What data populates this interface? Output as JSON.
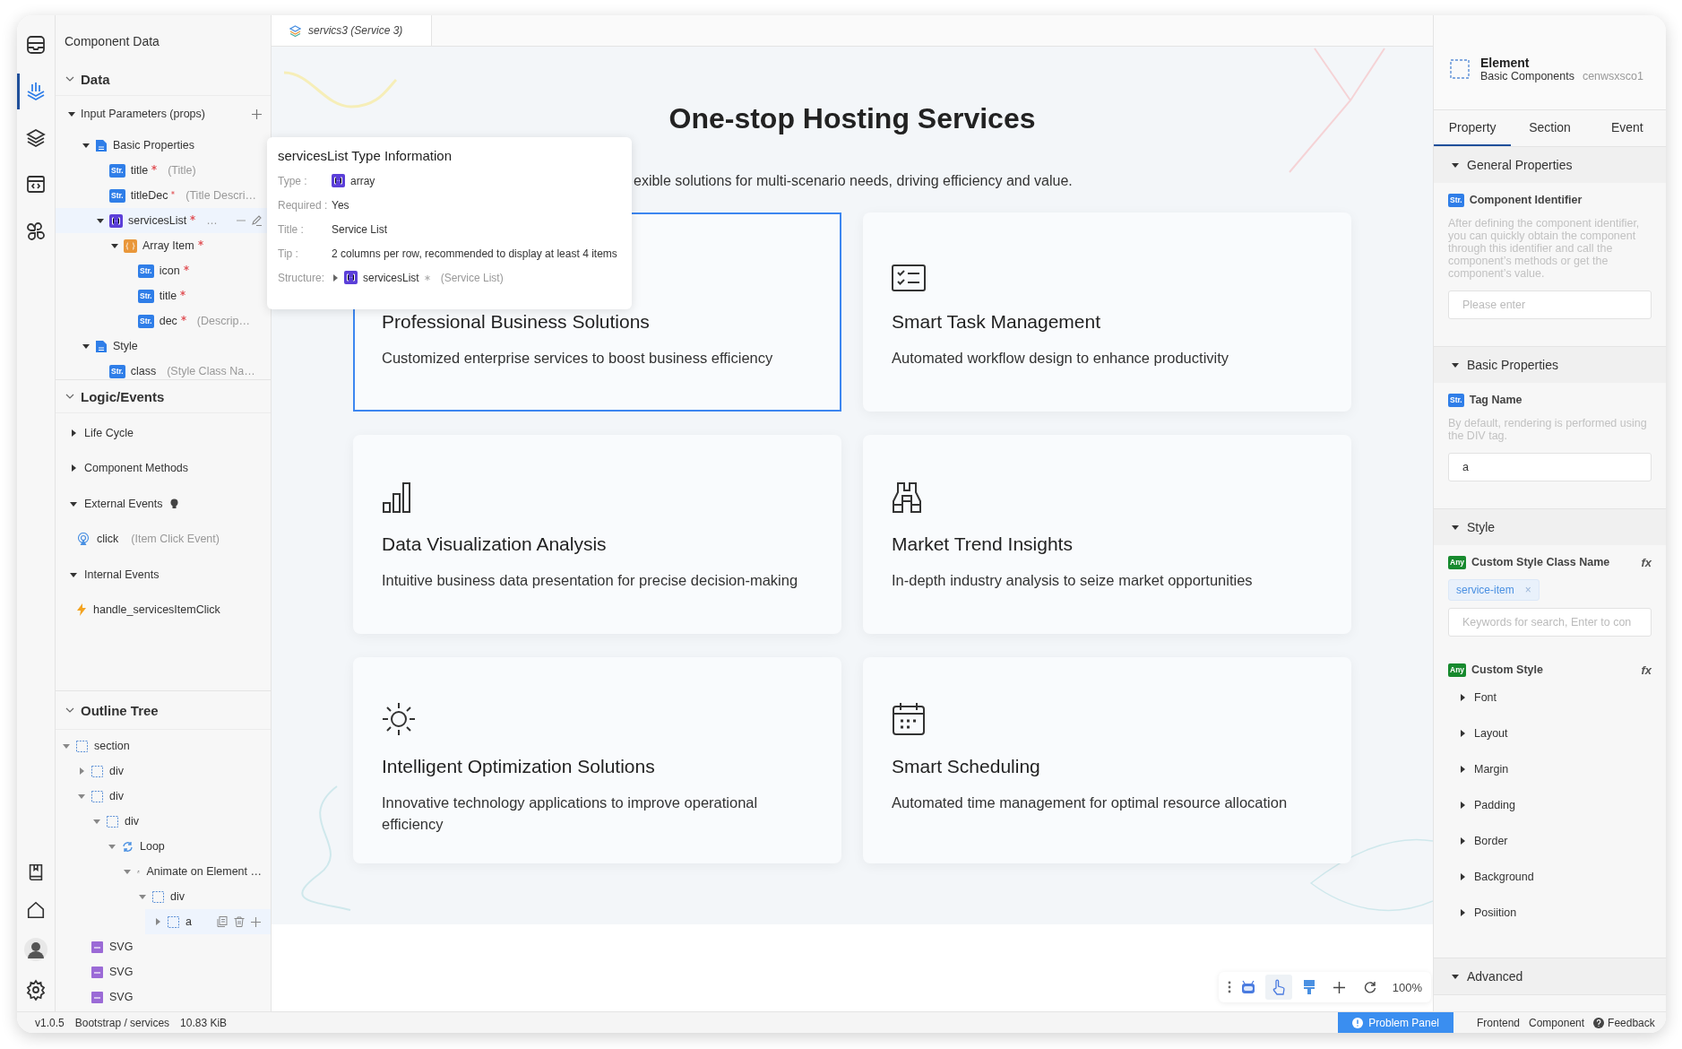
{
  "rail": {
    "top": [
      {
        "selected": false
      },
      {
        "selected": true
      },
      {
        "selected": false
      },
      {
        "selected": false
      },
      {
        "selected": false
      }
    ]
  },
  "left_panel": {
    "title": "Component Data",
    "data": {
      "title": "Data",
      "expanded": true,
      "tree": [
        {
          "kind": "props",
          "label": "Input Parameters (props)",
          "expanded": true,
          "selected": false,
          "children": [
            {
              "kind": "group",
              "label": "Basic Properties",
              "expanded": true,
              "selected": false,
              "children": [
                {
                  "kind": "str",
                  "badge": "Str.",
                  "label": "title",
                  "required": true,
                  "desc": "(Title)",
                  "selected": false
                },
                {
                  "kind": "str",
                  "badge": "Str.",
                  "label": "titleDec",
                  "required": true,
                  "desc": "(Title Descri…",
                  "selected": false
                },
                {
                  "kind": "array",
                  "label": "servicesList",
                  "required": true,
                  "desc": "…",
                  "expanded": true,
                  "selected": true,
                  "children": [
                    {
                      "kind": "item",
                      "label": "Array Item",
                      "required": true,
                      "expanded": true,
                      "selected": false,
                      "children": [
                        {
                          "kind": "str",
                          "badge": "Str.",
                          "label": "icon",
                          "required": true,
                          "selected": false
                        },
                        {
                          "kind": "str",
                          "badge": "Str.",
                          "label": "title",
                          "required": true,
                          "selected": false
                        },
                        {
                          "kind": "str",
                          "badge": "Str.",
                          "label": "dec",
                          "required": true,
                          "desc": "(Descrip…",
                          "selected": false
                        }
                      ]
                    }
                  ]
                }
              ]
            },
            {
              "kind": "group",
              "label": "Style",
              "expanded": true,
              "selected": false,
              "children": [
                {
                  "kind": "str",
                  "badge": "Str.",
                  "label": "class",
                  "required": false,
                  "desc": "(Style Class Na…",
                  "selected": false
                }
              ]
            }
          ]
        }
      ]
    },
    "logic": {
      "title": "Logic/Events",
      "expanded": true,
      "items": [
        {
          "kind": "group",
          "label": "Life Cycle",
          "expanded": false
        },
        {
          "kind": "group",
          "label": "Component Methods",
          "expanded": false
        },
        {
          "kind": "group",
          "label": "External Events",
          "expanded": true,
          "tip": true,
          "children": [
            {
              "kind": "event",
              "label": "click",
              "desc": "(Item Click Event)"
            }
          ]
        },
        {
          "kind": "group",
          "label": "Internal Events",
          "expanded": true,
          "children": [
            {
              "kind": "handler",
              "label": "handle_servicesItemClick"
            }
          ]
        }
      ]
    },
    "outline": {
      "title": "Outline Tree",
      "expanded": true,
      "tree": [
        {
          "kind": "element",
          "label": "section",
          "expanded": true,
          "selected": false,
          "children": [
            {
              "kind": "element",
              "label": "div",
              "expanded": false,
              "selected": false
            },
            {
              "kind": "element",
              "label": "div",
              "expanded": true,
              "selected": false,
              "children": [
                {
                  "kind": "element",
                  "label": "div",
                  "expanded": true,
                  "selected": false,
                  "children": [
                    {
                      "kind": "loop",
                      "label": "Loop",
                      "expanded": true,
                      "selected": false,
                      "children": [
                        {
                          "kind": "animate",
                          "label": "Animate on Element …",
                          "expanded": true,
                          "selected": false,
                          "children": [
                            {
                              "kind": "element",
                              "label": "div",
                              "expanded": true,
                              "selected": false,
                              "children": [
                                {
                                  "kind": "element",
                                  "label": "a",
                                  "expanded": false,
                                  "selected": true
                                }
                              ]
                            }
                          ]
                        }
                      ]
                    }
                  ]
                }
              ]
            },
            {
              "kind": "svg",
              "label": "SVG",
              "selected": false
            },
            {
              "kind": "svg",
              "label": "SVG",
              "selected": false
            },
            {
              "kind": "svg",
              "label": "SVG",
              "selected": false
            }
          ]
        }
      ]
    }
  },
  "canvas": {
    "tab": "servics3 (Service 3)",
    "title": "One-stop Hosting Services",
    "subtitle": "exible solutions for multi-scenario needs, driving efficiency and value.",
    "cards": [
      {
        "title": "Professional Business Solutions",
        "desc": "Customized enterprise services to boost business efficiency",
        "selected": true
      },
      {
        "title": "Smart Task Management",
        "desc": "Automated workflow design to enhance productivity",
        "selected": false
      },
      {
        "title": "Data Visualization Analysis",
        "desc": "Intuitive business data presentation for precise decision-making",
        "selected": false
      },
      {
        "title": "Market Trend Insights",
        "desc": "In-depth industry analysis to seize market opportunities",
        "selected": false
      },
      {
        "title": "Intelligent Optimization Solutions",
        "desc": "Innovative technology applications to improve operational efficiency",
        "selected": false
      },
      {
        "title": "Smart Scheduling",
        "desc": "Automated time management for optimal resource allocation",
        "selected": false
      }
    ],
    "tools": [
      {
        "selected": false
      },
      {
        "selected": true
      },
      {
        "selected": false
      },
      {
        "selected": false
      },
      {
        "selected": false
      }
    ],
    "zoom": "100%"
  },
  "tooltip": {
    "title": "servicesList Type Information",
    "rows": [
      {
        "kind": "type",
        "label": "Type :",
        "value": "array"
      },
      {
        "kind": "text",
        "label": "Required :",
        "value": "Yes"
      },
      {
        "kind": "text",
        "label": "Title :",
        "value": "Service List"
      },
      {
        "kind": "text",
        "label": "Tip :",
        "value": "2 columns per row, recommended to display at least 4 items"
      },
      {
        "kind": "structure",
        "label": "Structure:",
        "value": "servicesList",
        "required": true,
        "desc": "(Service List)"
      }
    ]
  },
  "inspector": {
    "element": {
      "title": "Element",
      "category": "Basic Components",
      "id": "cenwsxsco1"
    },
    "tabs": [
      {
        "label": "Property",
        "selected": true
      },
      {
        "label": "Section",
        "selected": false
      },
      {
        "label": "Event",
        "selected": false
      }
    ],
    "sections": [
      {
        "title": "General Properties",
        "expanded": true,
        "fields": [
          {
            "kind": "input",
            "badge": "Str.",
            "label": "Component Identifier",
            "help": "After defining the component identifier, you can quickly obtain the component through this identifier and call the component’s methods or get the component’s value.",
            "placeholder": "Please enter"
          }
        ]
      },
      {
        "title": "Basic Properties",
        "expanded": true,
        "fields": [
          {
            "kind": "input",
            "badge": "Str.",
            "label": "Tag Name",
            "help": "By default, rendering is performed using the DIV tag.",
            "value": "a"
          }
        ]
      },
      {
        "title": "Style",
        "expanded": true,
        "fields": [
          {
            "kind": "tags",
            "badge": "Any",
            "label": "Custom Style Class Name",
            "fx": "fx",
            "tags": [
              {
                "label": "service-item",
                "remove": "×"
              }
            ],
            "placeholder": "Keywords for search, Enter to con"
          },
          {
            "kind": "groups",
            "badge": "Any",
            "label": "Custom Style",
            "fx": "fx",
            "groups": [
              {
                "label": "Font",
                "expanded": false
              },
              {
                "label": "Layout",
                "expanded": false
              },
              {
                "label": "Margin",
                "expanded": false
              },
              {
                "label": "Padding",
                "expanded": false
              },
              {
                "label": "Border",
                "expanded": false
              },
              {
                "label": "Background",
                "expanded": false
              },
              {
                "label": "Posiition",
                "expanded": false
              }
            ]
          }
        ]
      },
      {
        "title": "Advanced",
        "expanded": true
      }
    ]
  },
  "status_bar": {
    "version": "v1.0.5",
    "path": "Bootstrap / services",
    "size": "10.83 KiB",
    "problem_button": "Problem Panel",
    "links": [
      "Frontend",
      "Component"
    ],
    "feedback": "Feedback"
  }
}
